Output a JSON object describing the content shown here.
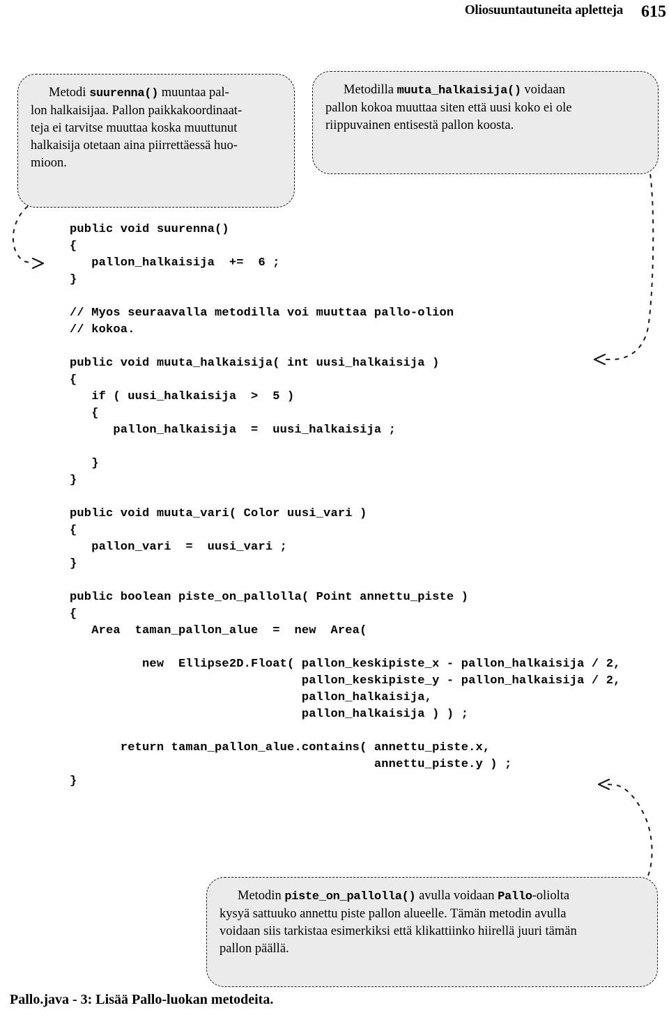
{
  "header": {
    "title": "Oliosuuntautuneita apletteja",
    "page_number": "615"
  },
  "callouts": {
    "suurenna": {
      "line1_pre": "Metodi ",
      "line1_code": "suurenna()",
      "line1_post": " muuntaa pal-",
      "line2": "lon halkaisijaa. Pallon paikkakoordinaat-",
      "line3": "teja ei tarvitse muuttaa koska muuttunut",
      "line4": "halkaisija otetaan aina piirrettäessä huo-",
      "line5": "mioon."
    },
    "muuta_halkaisija": {
      "line1_pre": "Metodilla ",
      "line1_code": "muuta_halkaisija()",
      "line1_post": " voidaan",
      "line2": "pallon kokoa muuttaa siten että uusi koko ei ole",
      "line3": "riippuvainen entisestä pallon koosta."
    },
    "piste_on_pallolla": {
      "line1_pre": "Metodin ",
      "line1_code": "piste_on_pallolla()",
      "line1_mid": " avulla voidaan ",
      "line1_code2": "Pallo",
      "line1_post": "-oliolta",
      "line2": "kysyä sattuuko annettu piste pallon alueelle. Tämän metodin avulla",
      "line3": "voidaan siis tarkistaa esimerkiksi että klikattiinko hiirellä juuri tämän",
      "line4": "pallon päällä."
    }
  },
  "code": {
    "language": "java",
    "lines": [
      "public void suurenna()",
      "{",
      "   pallon_halkaisija  +=  6 ;",
      "}",
      "",
      "// Myos seuraavalla metodilla voi muuttaa pallo-olion",
      "// kokoa.",
      "",
      "public void muuta_halkaisija( int uusi_halkaisija )",
      "{",
      "   if ( uusi_halkaisija  >  5 )",
      "   {",
      "      pallon_halkaisija  =  uusi_halkaisija ;",
      "",
      "   }",
      "}",
      "",
      "public void muuta_vari( Color uusi_vari )",
      "{",
      "   pallon_vari  =  uusi_vari ;",
      "}",
      "",
      "public boolean piste_on_pallolla( Point annettu_piste )",
      "{",
      "   Area  taman_pallon_alue  =  new  Area(",
      "",
      "          new  Ellipse2D.Float( pallon_keskipiste_x - pallon_halkaisija / 2,",
      "                                pallon_keskipiste_y - pallon_halkaisija / 2,",
      "                                pallon_halkaisija,",
      "                                pallon_halkaisija ) ) ;",
      "",
      "       return taman_pallon_alue.contains( annettu_piste.x,",
      "                                          annettu_piste.y ) ;",
      "}"
    ]
  },
  "caption": {
    "text": "Pallo.java - 3:  Lisää Pallo-luokan metodeita."
  },
  "connectors": [
    {
      "name": "suurenna-connector",
      "from": "callout-suurenna",
      "to": "code-line-suurenna",
      "arrow_direction": "right"
    },
    {
      "name": "muuta-halkaisija-connector",
      "from": "callout-muuta-halkaisija",
      "to": "code-line-muuta-halkaisija",
      "arrow_direction": "left"
    },
    {
      "name": "piste-on-pallolla-connector",
      "from": "callout-piste-on-pallolla",
      "to": "code-line-piste-on-pallolla",
      "arrow_direction": "left"
    }
  ],
  "colors": {
    "callout_fill": "#ebebeb",
    "callout_border": "#1a1a1a",
    "text": "#000000",
    "page_background": "#ffffff"
  }
}
